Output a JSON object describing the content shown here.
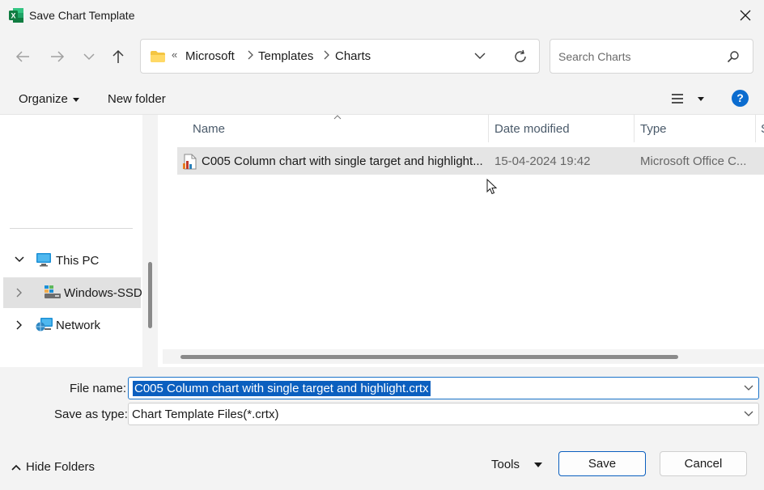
{
  "window": {
    "title": "Save Chart Template",
    "app_icon": "excel-icon"
  },
  "navigation": {
    "breadcrumb": [
      "Microsoft",
      "Templates",
      "Charts"
    ],
    "overflow": "«",
    "search_placeholder": "Search Charts"
  },
  "toolbar": {
    "organize_label": "Organize",
    "new_folder_label": "New folder",
    "help_label": "?"
  },
  "sidebar": {
    "items": [
      {
        "label": "This PC",
        "icon": "computer-icon",
        "expanded": true
      },
      {
        "label": "Windows-SSD",
        "icon": "drive-icon",
        "selected": true
      },
      {
        "label": "Network",
        "icon": "network-icon"
      }
    ]
  },
  "file_list": {
    "columns": [
      "Name",
      "Date modified",
      "Type",
      "S"
    ],
    "rows": [
      {
        "name": "C005 Column chart with single target and highlight...",
        "date_modified": "15-04-2024 19:42",
        "type": "Microsoft Office C..."
      }
    ]
  },
  "save_form": {
    "file_name_label": "File name:",
    "file_name_value": "C005 Column chart with single target and highlight.crtx",
    "save_type_label": "Save as type:",
    "save_type_value": "Chart Template Files(*.crtx)"
  },
  "footer": {
    "hide_folders_label": "Hide Folders",
    "tools_label": "Tools",
    "save_label": "Save",
    "cancel_label": "Cancel"
  },
  "colors": {
    "accent": "#0b5fbf",
    "help": "#0b6ccf",
    "excel": "#107c41",
    "folder": "#f4c542"
  }
}
